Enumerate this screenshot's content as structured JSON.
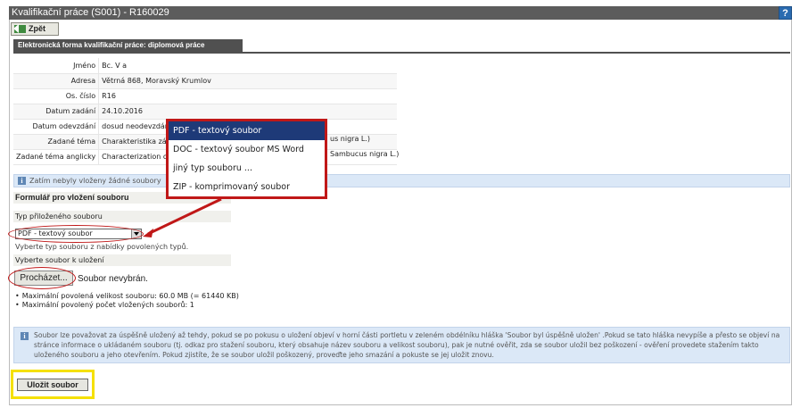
{
  "window": {
    "title": "Kvalifikační práce (S001) - R160029",
    "help": "?"
  },
  "nav": {
    "back_label": "Zpět"
  },
  "section": {
    "title": "Elektronická forma kvalifikační práce: diplomová práce"
  },
  "info_rows": [
    {
      "label": "Jméno",
      "value": "Bc. V                     a"
    },
    {
      "label": "Adresa",
      "value": "Větrná 868, Moravský Krumlov"
    },
    {
      "label": "Os. číslo",
      "value": "R16"
    },
    {
      "label": "Datum zadání",
      "value": "24.10.2016"
    },
    {
      "label": "Datum odevzdání",
      "value": "dosud neodevzdáno"
    },
    {
      "label": "Zadané téma",
      "value": "Charakteristika zástu"
    },
    {
      "label": "Zadané téma anglicky",
      "value": "Characterization of w"
    }
  ],
  "info_tails": {
    "topic": "us nigra L.)",
    "topic_en": "Sambucus nigra L.)"
  },
  "banner": {
    "text": "Zatím nebyly vloženy žádné soubory"
  },
  "form": {
    "title": "Formulář pro vložení souboru",
    "type_label": "Typ přiloženého souboru",
    "type_value": "PDF - textový soubor",
    "type_hint": "Vyberte typ souboru z nabídky povolených typů.",
    "file_label": "Vyberte soubor k uložení",
    "browse_label": "Procházet...",
    "no_file": "Soubor nevybrán.",
    "limits": [
      "Maximální povolená velikost souboru: 60.0 MB (= 61440 KB)",
      "Maximální povolený počet vložených souborů: 1"
    ],
    "notice": "Soubor lze považovat za úspěšně uložený až tehdy, pokud se po pokusu o uložení objeví v horní části portletu v zeleném obdélníku hláška 'Soubor byl úspěšně uložen' .Pokud se tato hláška nevypíše a přesto se objeví na stránce informace o ukládaném souboru (tj. odkaz pro stažení souboru, který obsahuje název souboru a velikost souboru), pak je nutné ověřit, zda se soubor uložil bez poškození - ověření provedete stažením takto uloženého souboru a jeho otevřením. Pokud zjistíte, že se soubor uložil poškozený, proveďte jeho smazání a pokuste se jej uložit znovu.",
    "save_label": "Uložit soubor"
  },
  "dropdown_options": [
    "PDF - textový soubor",
    "DOC - textový soubor MS Word",
    "jiný typ souboru ...",
    "ZIP - komprimovaný soubor"
  ],
  "colors": {
    "titlebar": "#5c5c5c",
    "highlight_red": "#c01818",
    "highlight_yellow": "#f5e000",
    "info_bg": "#dbe8f7",
    "selected_option": "#1e3a78"
  },
  "icons": {
    "back": "back-arrow-icon",
    "info": "info-icon",
    "help": "help-icon"
  }
}
